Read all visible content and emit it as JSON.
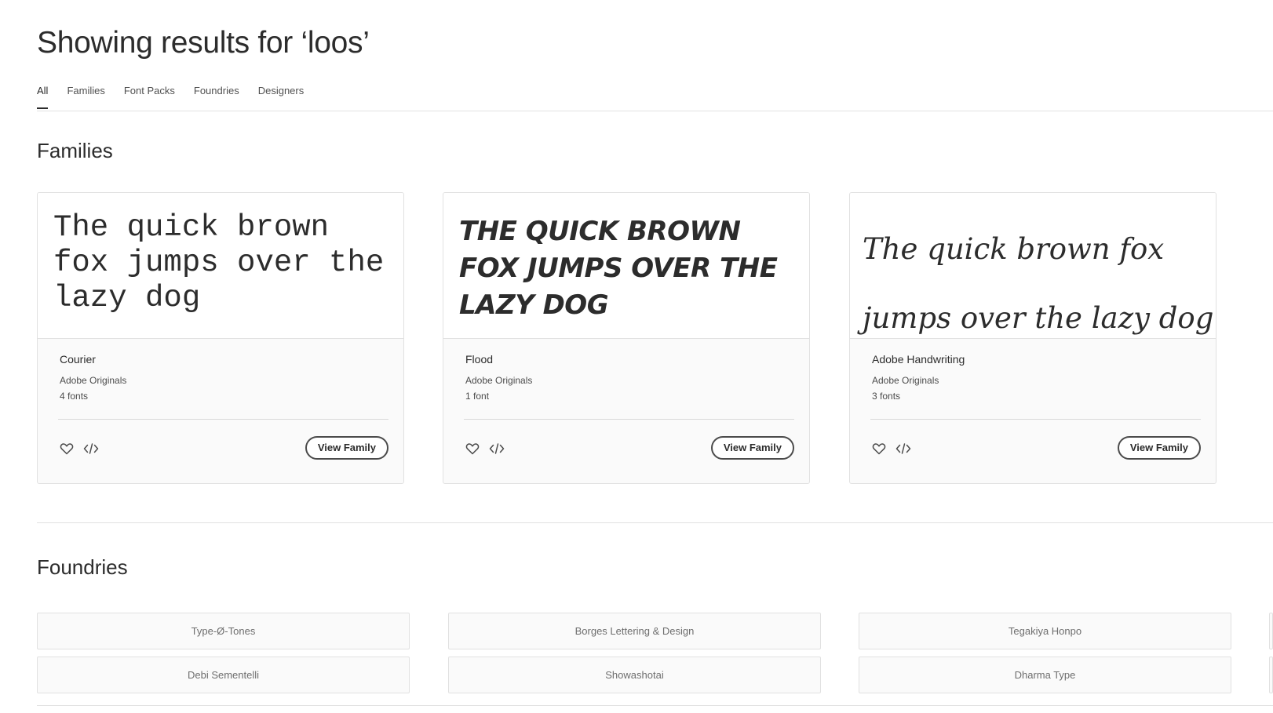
{
  "header": {
    "title": "Showing results for ‘loos’"
  },
  "tabs": [
    {
      "label": "All",
      "active": true
    },
    {
      "label": "Families",
      "active": false
    },
    {
      "label": "Font Packs",
      "active": false
    },
    {
      "label": "Foundries",
      "active": false
    },
    {
      "label": "Designers",
      "active": false
    }
  ],
  "families": {
    "title": "Families",
    "cards": [
      {
        "preview": "The quick brown fox jumps over the lazy dog",
        "name": "Courier",
        "foundry": "Adobe Originals",
        "count": "4 fonts",
        "button": "View Family"
      },
      {
        "preview": "THE QUICK BROWN FOX JUMPS OVER THE LAZY DOG",
        "name": "Flood",
        "foundry": "Adobe Originals",
        "count": "1 font",
        "button": "View Family"
      },
      {
        "preview_line1": "The quick brown fox",
        "preview_line2": "jumps over the lazy dog",
        "name": "Adobe Handwriting",
        "foundry": "Adobe Originals",
        "count": "3 fonts",
        "button": "View Family"
      }
    ],
    "icons": {
      "favorite": "heart-icon",
      "embed": "code-icon"
    }
  },
  "foundries": {
    "title": "Foundries",
    "items": [
      "Type-Ø-Tones",
      "Borges Lettering & Design",
      "Tegakiya Honpo",
      "Debi Sementelli",
      "Showashotai",
      "Dharma Type"
    ]
  }
}
